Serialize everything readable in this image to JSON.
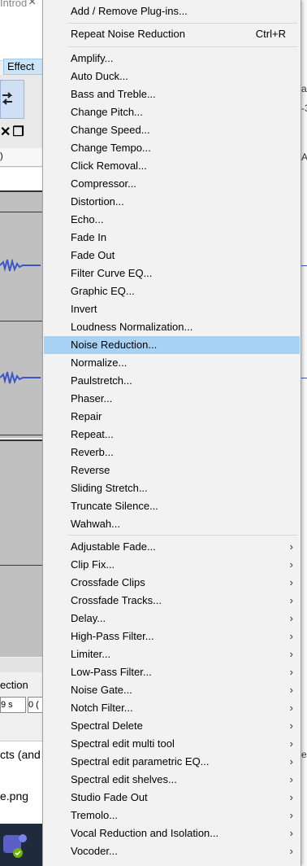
{
  "background": {
    "title_fragment": "Introd",
    "close_glyph": "×",
    "effect_menu_label": "Effect",
    "ruler_fragment": ")",
    "selection_label": "ection",
    "selection_ctl1": "9 s",
    "selection_ctl2": "0 (",
    "file_row1": "cts (and",
    "file_row2": "e.png",
    "right_fragments": [
      "a",
      "-3",
      "A",
      "e"
    ]
  },
  "menu": {
    "top_items": [
      {
        "label": "Add / Remove Plug-ins..."
      },
      {
        "label": "Repeat Noise Reduction",
        "shortcut": "Ctrl+R"
      }
    ],
    "effects": [
      "Amplify...",
      "Auto Duck...",
      "Bass and Treble...",
      "Change Pitch...",
      "Change Speed...",
      "Change Tempo...",
      "Click Removal...",
      "Compressor...",
      "Distortion...",
      "Echo...",
      "Fade In",
      "Fade Out",
      "Filter Curve EQ...",
      "Graphic EQ...",
      "Invert",
      "Loudness Normalization...",
      "Noise Reduction...",
      "Normalize...",
      "Paulstretch...",
      "Phaser...",
      "Repair",
      "Repeat...",
      "Reverb...",
      "Reverse",
      "Sliding Stretch...",
      "Truncate Silence...",
      "Wahwah..."
    ],
    "highlighted": "Noise Reduction...",
    "submenus": [
      "Adjustable Fade...",
      "Clip Fix...",
      "Crossfade Clips",
      "Crossfade Tracks...",
      "Delay...",
      "High-Pass Filter...",
      "Limiter...",
      "Low-Pass Filter...",
      "Noise Gate...",
      "Notch Filter...",
      "Spectral Delete",
      "Spectral edit multi tool",
      "Spectral edit parametric EQ...",
      "Spectral edit shelves...",
      "Studio Fade Out",
      "Tremolo...",
      "Vocal Reduction and Isolation...",
      "Vocoder..."
    ],
    "submenu_arrow": "›"
  },
  "colors": {
    "highlight": "#a8d2f3",
    "menu_bg": "#f2f2f2",
    "waveform": "#3d56c6"
  }
}
